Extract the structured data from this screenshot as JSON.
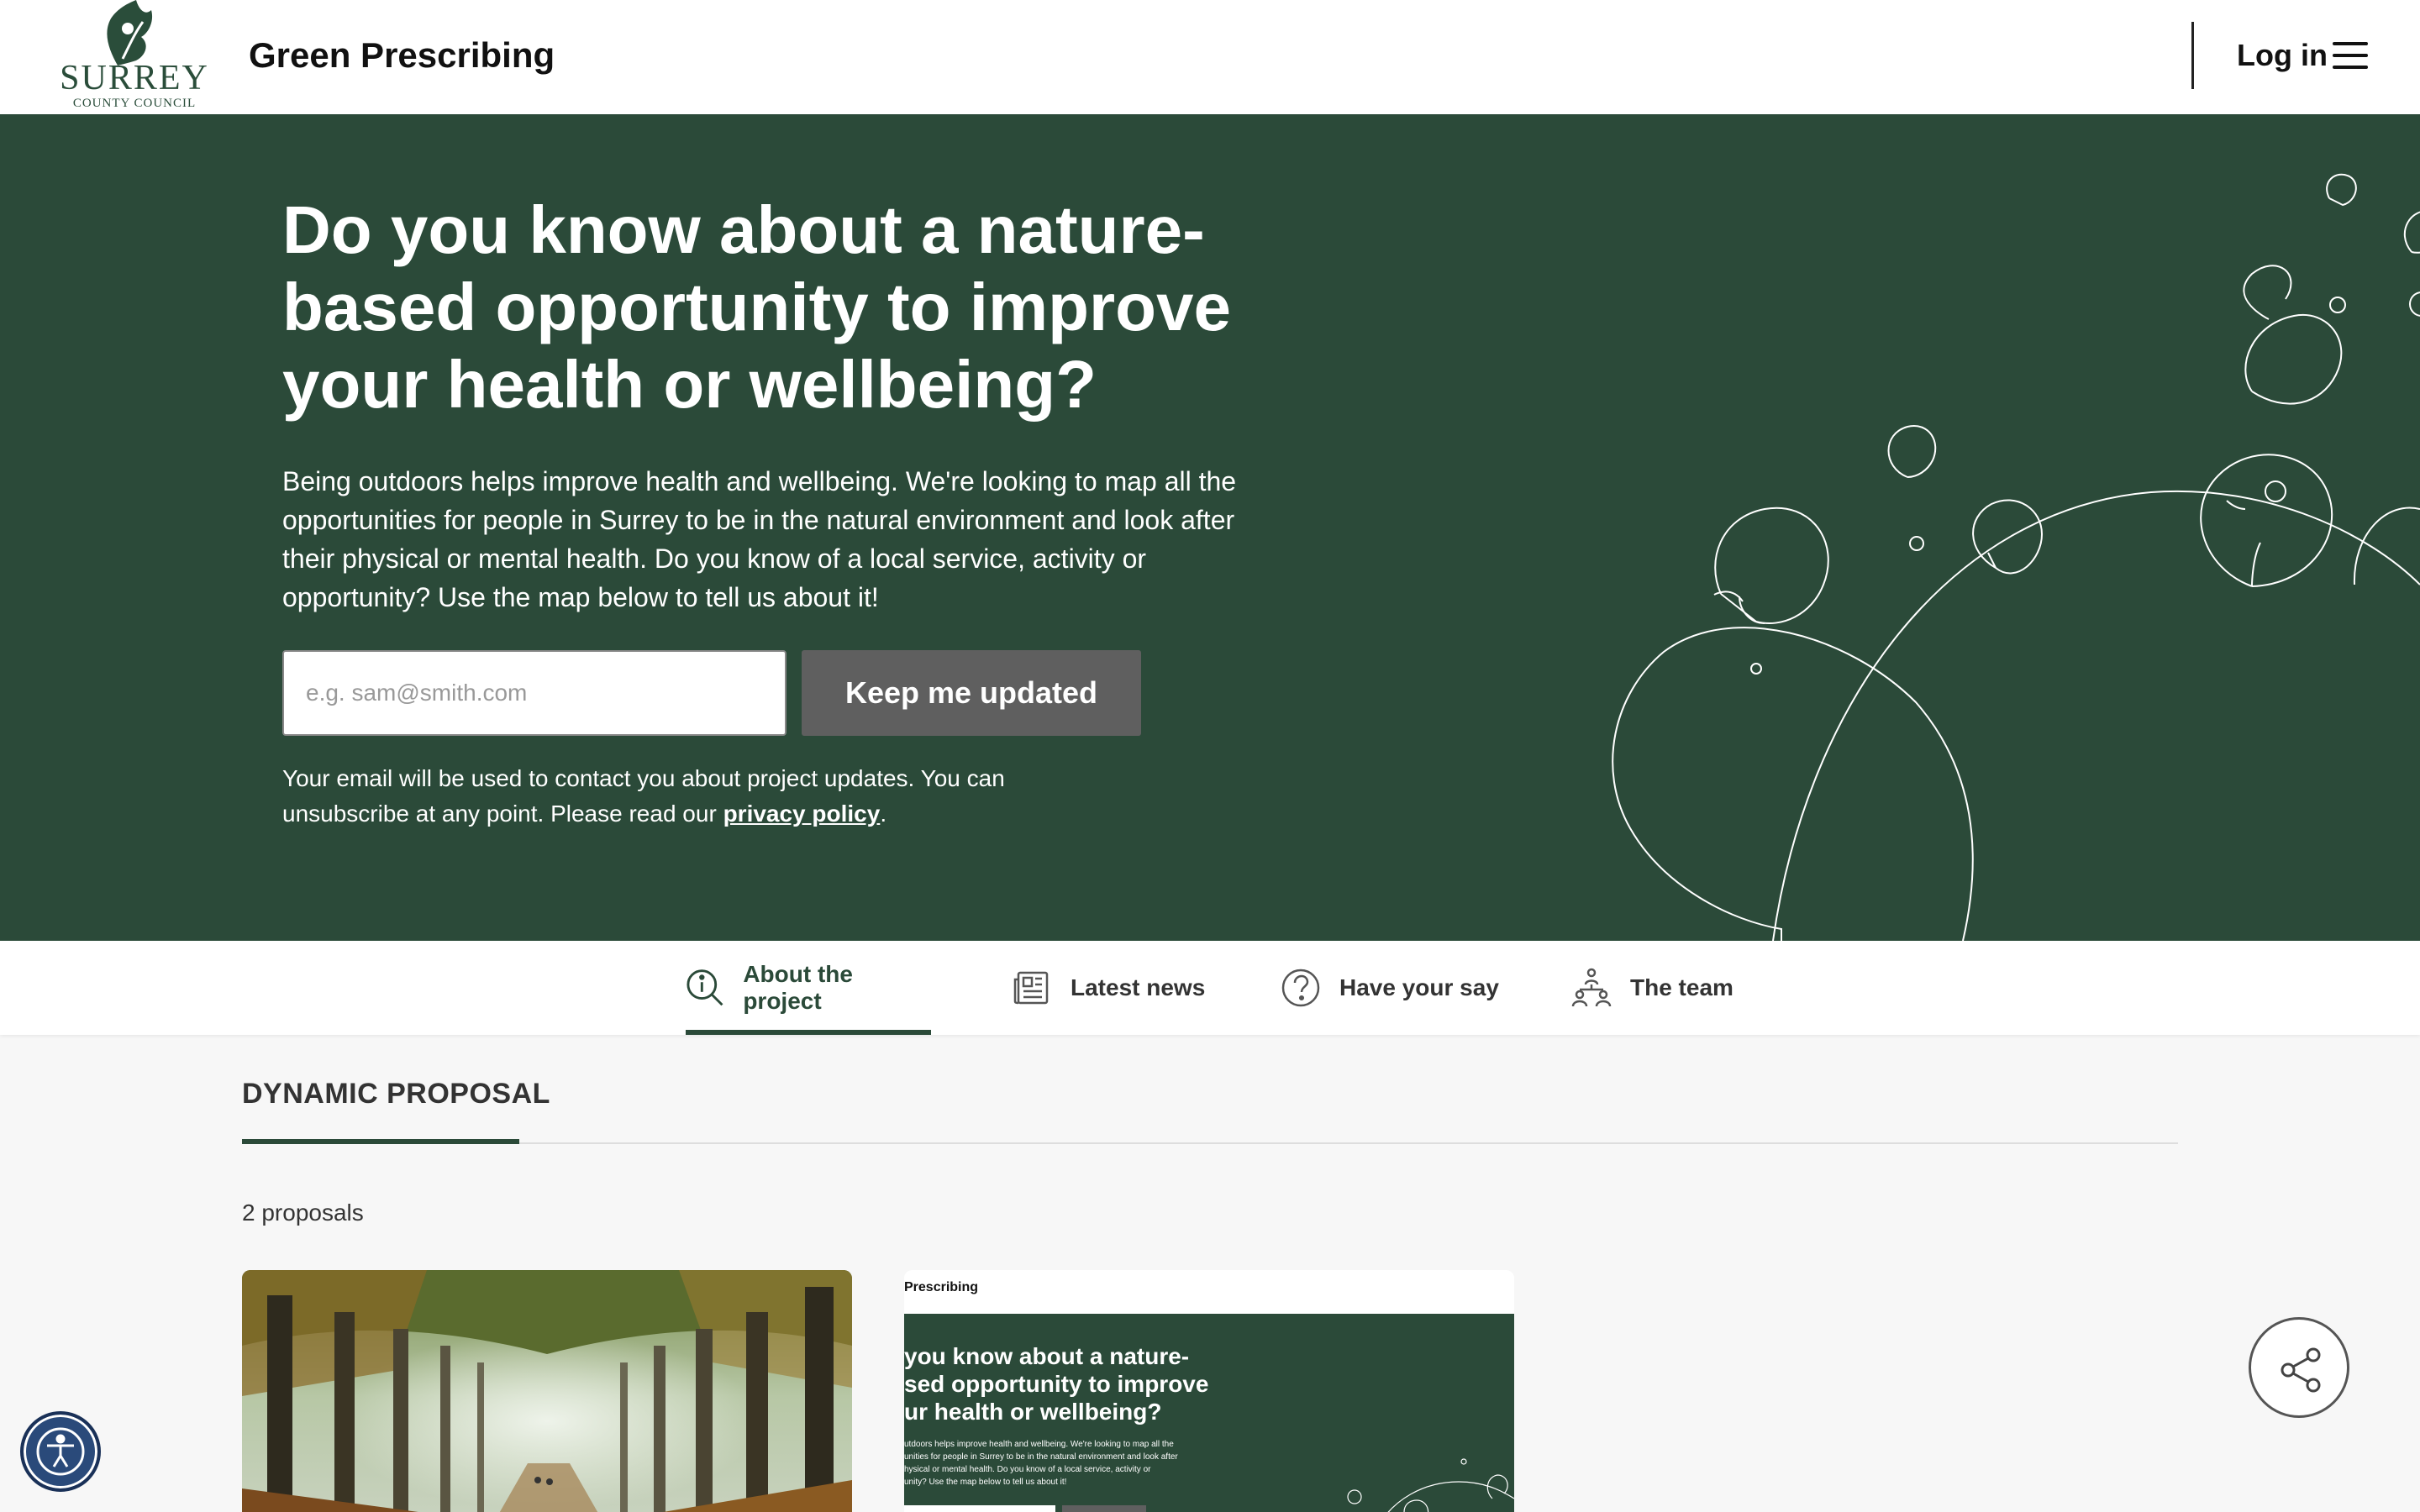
{
  "header": {
    "logo_word": "SURREY",
    "logo_sub": "COUNTY COUNCIL",
    "site_title": "Green Prescribing",
    "login_label": "Log in",
    "menu_icon": "hamburger-menu-icon"
  },
  "hero": {
    "heading": "Do you know about a nature-based opportunity to improve your health or wellbeing?",
    "body": "Being outdoors helps improve health and wellbeing. We're looking to map all the opportunities for people in Surrey to be in the natural environment and look after their physical or mental health. Do you know of a local service, activity or opportunity? Use the map below to tell us about it!",
    "email_placeholder": "e.g. sam@smith.com",
    "button_label": "Keep me updated",
    "note_before": "Your email will be used to contact you about project updates. You can unsubscribe at any point. Please read our ",
    "note_link": "privacy policy",
    "note_after": ".",
    "background_color": "#2b4a39"
  },
  "tabs": [
    {
      "label": "About the project",
      "icon": "info-search-icon",
      "active": true
    },
    {
      "label": "Latest news",
      "icon": "newspaper-icon",
      "active": false
    },
    {
      "label": "Have your say",
      "icon": "question-icon",
      "active": false
    },
    {
      "label": "The team",
      "icon": "team-icon",
      "active": false
    }
  ],
  "content": {
    "section_title": "DYNAMIC PROPOSAL",
    "proposal_count": "2 proposals",
    "card2": {
      "mini_title": "Prescribing",
      "mini_heading": " you know about a nature-\nsed opportunity to improve\nur health or wellbeing?",
      "mini_body": "utdoors helps improve health and wellbeing. We're looking to map all the\nunities for people in Surrey to be in the natural environment and look after\nhysical or mental health. Do you know of a local service, activity or\nunity? Use the map below to tell us about it!"
    }
  },
  "floating": {
    "share_icon": "share-icon",
    "accessibility_icon": "accessibility-icon"
  },
  "colors": {
    "brand_green": "#2b4a39",
    "button_grey": "#5f5f5f"
  }
}
